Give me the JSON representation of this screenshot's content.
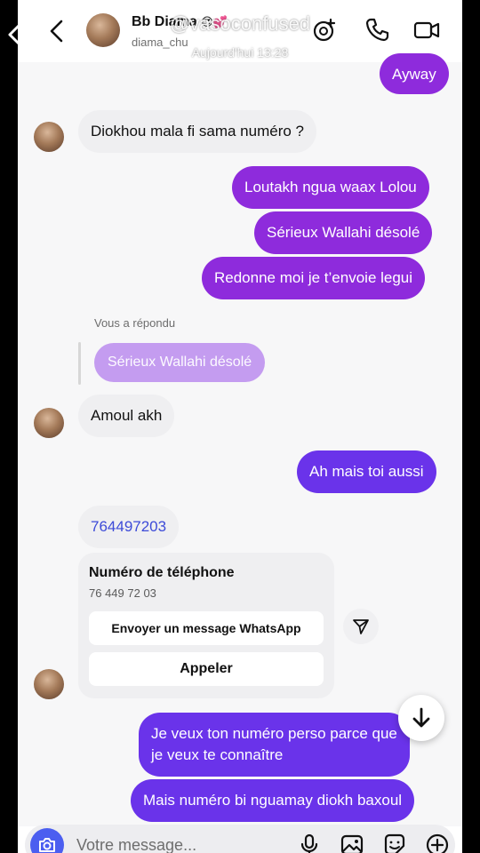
{
  "header": {
    "name": "Bb Diama",
    "name_emoji": "😍💕",
    "username": "diama_chu"
  },
  "overlay": {
    "title": "@vasoconfused",
    "timestamp": "Aujourd'hui 13:28"
  },
  "messages": {
    "m0": "Ayway",
    "m1": "Diokhou mala fi sama numéro ?",
    "m2": "Loutakh ngua waax Lolou",
    "m3": "Sérieux Wallahi désolé",
    "m4": "Redonne moi je t’envoie legui",
    "reply_label": "Vous a répondu",
    "reply_quote": "Sérieux Wallahi désolé",
    "m5": "Amoul akh",
    "m6": "Ah mais toi aussi",
    "m7": "764497203",
    "m8_line1": "Je veux ton numéro perso parce que",
    "m8_line2": "je veux te connaître",
    "m9": "Mais numéro bi nguamay diokh baxoul"
  },
  "phone_card": {
    "title": "Numéro de téléphone",
    "number": "76 449 72 03",
    "whatsapp_button": "Envoyer un message WhatsApp",
    "call_button": "Appeler"
  },
  "composer": {
    "placeholder": "Votre message..."
  },
  "colors": {
    "bubble_purple": "#8e2bdc",
    "bubble_blue_purple": "#6a33ea",
    "reply_bubble": "#c49cf0",
    "incoming_bubble": "#efeff1",
    "link_blue": "#3d4bd8",
    "camera_button": "#4b5ef0"
  },
  "icons": [
    "back-icon",
    "video-call-icon",
    "phone-icon",
    "video-icon",
    "send-icon",
    "arrow-down-icon",
    "camera-icon",
    "microphone-icon",
    "gallery-icon",
    "sticker-icon",
    "plus-icon",
    "chevron-left-icon",
    "flag-icon"
  ]
}
